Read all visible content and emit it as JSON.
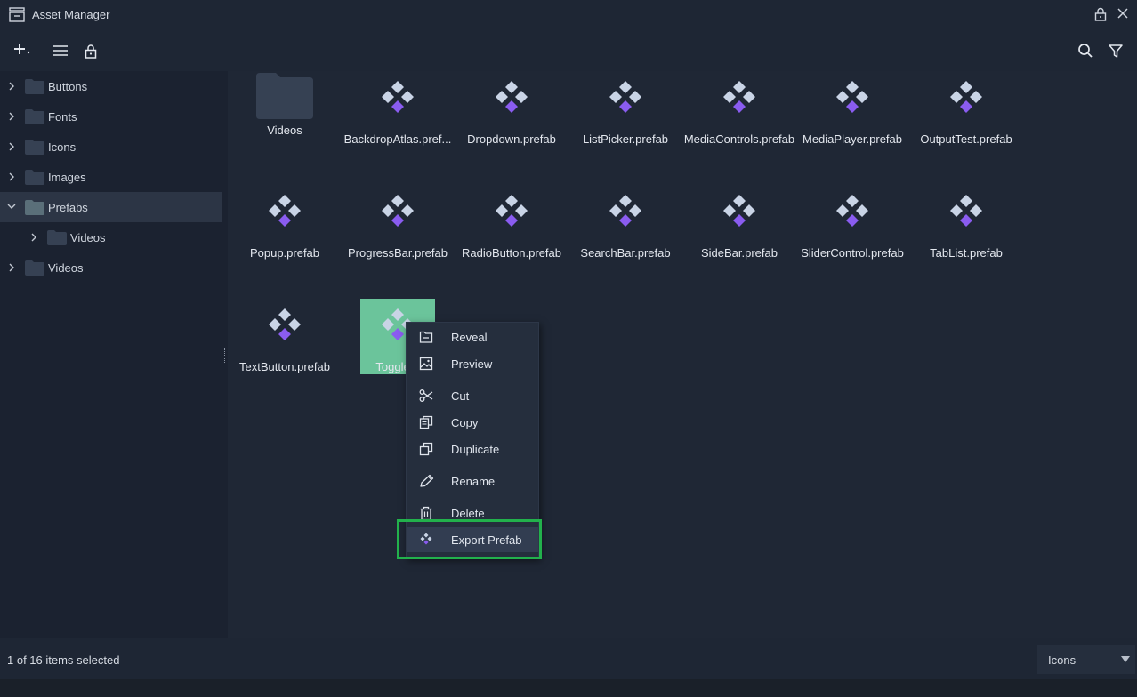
{
  "window": {
    "title": "Asset Manager"
  },
  "toolbar": {
    "add_icon": "plus-dropdown-icon",
    "list_icon": "hamburger-list-icon",
    "lock_icon": "lock-icon",
    "search_icon": "search-icon",
    "filter_icon": "filter-icon"
  },
  "sidebar": {
    "items": [
      {
        "label": "Buttons",
        "expanded": false,
        "level": 0
      },
      {
        "label": "Fonts",
        "expanded": false,
        "level": 0
      },
      {
        "label": "Icons",
        "expanded": false,
        "level": 0
      },
      {
        "label": "Images",
        "expanded": false,
        "level": 0
      },
      {
        "label": "Prefabs",
        "expanded": true,
        "level": 0,
        "selected": true
      },
      {
        "label": "Videos",
        "expanded": false,
        "level": 1
      },
      {
        "label": "Videos",
        "expanded": false,
        "level": 0
      }
    ]
  },
  "assets": [
    {
      "name": "Videos",
      "type": "folder"
    },
    {
      "name": "BackdropAtlas.prefab",
      "display": "BackdropAtlas.pref...",
      "type": "prefab"
    },
    {
      "name": "Dropdown.prefab",
      "type": "prefab"
    },
    {
      "name": "ListPicker.prefab",
      "type": "prefab"
    },
    {
      "name": "MediaControls.prefab",
      "type": "prefab"
    },
    {
      "name": "MediaPlayer.prefab",
      "type": "prefab"
    },
    {
      "name": "OutputTest.prefab",
      "type": "prefab"
    },
    {
      "name": "Popup.prefab",
      "type": "prefab"
    },
    {
      "name": "ProgressBar.prefab",
      "type": "prefab"
    },
    {
      "name": "RadioButton.prefab",
      "type": "prefab"
    },
    {
      "name": "SearchBar.prefab",
      "type": "prefab"
    },
    {
      "name": "SideBar.prefab",
      "type": "prefab"
    },
    {
      "name": "SliderControl.prefab",
      "type": "prefab"
    },
    {
      "name": "TabList.prefab",
      "type": "prefab"
    },
    {
      "name": "TextButton.prefab",
      "type": "prefab"
    },
    {
      "name": "Toggle.prefab",
      "display": "Toggle.p",
      "type": "prefab",
      "selected": true
    }
  ],
  "context_menu": {
    "items": [
      {
        "label": "Reveal",
        "icon": "folder-open-icon"
      },
      {
        "label": "Preview",
        "icon": "image-preview-icon"
      },
      {
        "label": "Cut",
        "icon": "scissors-icon"
      },
      {
        "label": "Copy",
        "icon": "copy-icon"
      },
      {
        "label": "Duplicate",
        "icon": "duplicate-icon"
      },
      {
        "label": "Rename",
        "icon": "pencil-icon"
      },
      {
        "label": "Delete",
        "icon": "trash-icon"
      },
      {
        "label": "Export Prefab",
        "icon": "prefab-icon",
        "active": true
      }
    ]
  },
  "status": {
    "text": "1 of 16 items selected"
  },
  "view_mode": {
    "selected": "Icons"
  },
  "colors": {
    "accent_selected_tile": "#6bc49b",
    "prefab_top": "#c9d4e6",
    "prefab_bottom": "#8a5cf0",
    "highlight": "#22b14c"
  }
}
